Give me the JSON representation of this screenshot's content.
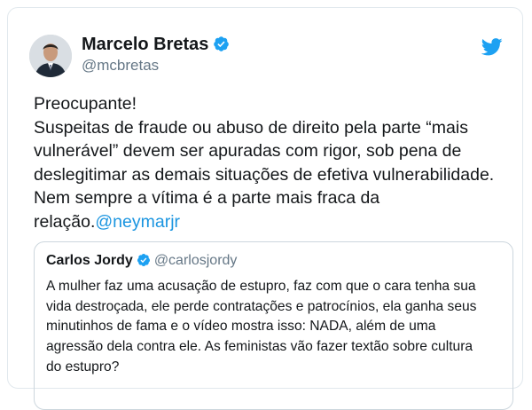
{
  "tweet": {
    "author_name": "Marcelo Bretas",
    "author_handle": "@mcbretas",
    "text_lines": [
      "Preocupante!",
      "Suspeitas de fraude ou abuso de direito pela parte “mais",
      "vulnerável” devem ser apuradas com rigor, sob pena de",
      "deslegitimar as demais situações de efetiva vulnerabilidade.",
      "Nem sempre a vítima é a parte mais fraca da"
    ],
    "last_line_prefix": "relação.",
    "mention": "@neymarjr"
  },
  "quoted": {
    "author_name": "Carlos Jordy",
    "author_handle": "@carlosjordy",
    "text_lines": [
      "A mulher faz uma acusação de estupro, faz com que o cara tenha sua",
      "vida destroçada, ele perde contratações e patrocínios, ela ganha seus",
      "minutinhos de fama e o vídeo mostra isso: NADA, além de uma",
      "agressão dela contra ele. As feministas vão fazer textão sobre cultura",
      "do estupro?"
    ]
  },
  "icons": {
    "verified": "verified-badge-icon",
    "brand": "twitter-bird-icon"
  },
  "colors": {
    "twitter_blue": "#1da1f2",
    "link_blue": "#1b95e0",
    "secondary_text": "#657786",
    "border": "#e1e8ed"
  }
}
